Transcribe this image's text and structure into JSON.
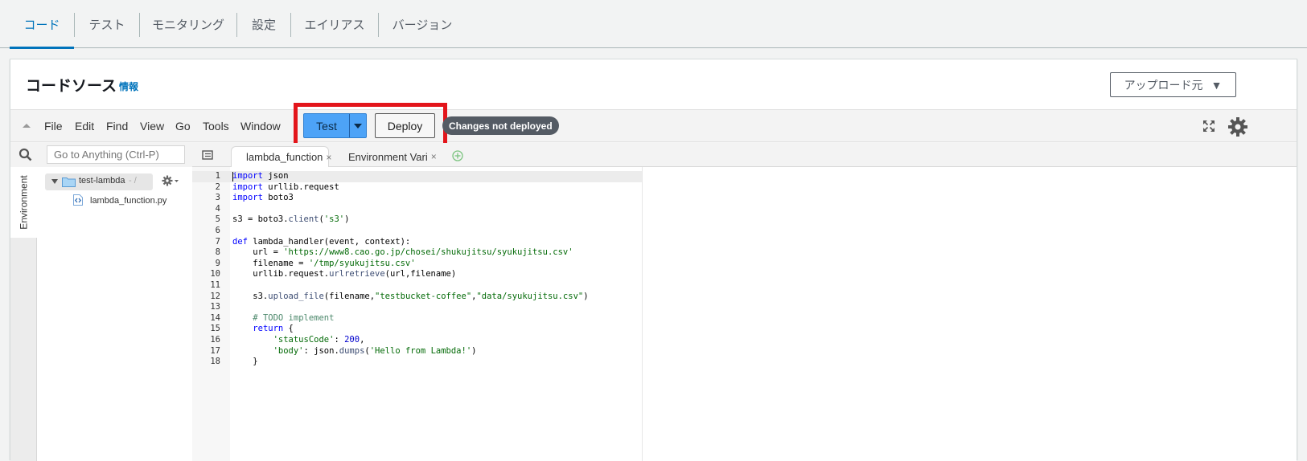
{
  "top_tabs": [
    {
      "label": "コード",
      "active": true
    },
    {
      "label": "テスト",
      "active": false
    },
    {
      "label": "モニタリング",
      "active": false
    },
    {
      "label": "設定",
      "active": false
    },
    {
      "label": "エイリアス",
      "active": false
    },
    {
      "label": "バージョン",
      "active": false
    }
  ],
  "panel": {
    "title": "コードソース",
    "info": "情報",
    "upload_label": "アップロード元",
    "upload_caret": "▼"
  },
  "toolbar": {
    "menus": [
      "File",
      "Edit",
      "Find",
      "View",
      "Go",
      "Tools",
      "Window"
    ],
    "test_label": "Test",
    "deploy_label": "Deploy",
    "changes_badge": "Changes not deployed"
  },
  "sidebar": {
    "search_placeholder": "Go to Anything (Ctrl-P)",
    "env_tab": "Environment",
    "root_folder": "test-lambda",
    "root_slash": "- /",
    "file": "lambda_function.py"
  },
  "editor_tabs": [
    {
      "label": "lambda_function",
      "close": "×",
      "active": true
    },
    {
      "label": "Environment Vari",
      "close": "×",
      "active": false
    }
  ],
  "code_lines": [
    "import json",
    "import urllib.request",
    "import boto3",
    "",
    "s3 = boto3.client('s3')",
    "",
    "def lambda_handler(event, context):",
    "    url = 'https://www8.cao.go.jp/chosei/shukujitsu/syukujitsu.csv'",
    "    filename = '/tmp/syukujitsu.csv'",
    "    urllib.request.urlretrieve(url,filename)",
    "",
    "    s3.upload_file(filename,\"testbucket-coffee\",\"data/syukujitsu.csv\")",
    "",
    "    # TODO implement",
    "    return {",
    "        'statusCode': 200,",
    "        'body': json.dumps('Hello from Lambda!')",
    "    }"
  ],
  "colors": {
    "accent": "#0073bb",
    "test_button": "#4da3f7",
    "highlight_box": "#e3151b",
    "badge_bg": "#545b64"
  }
}
